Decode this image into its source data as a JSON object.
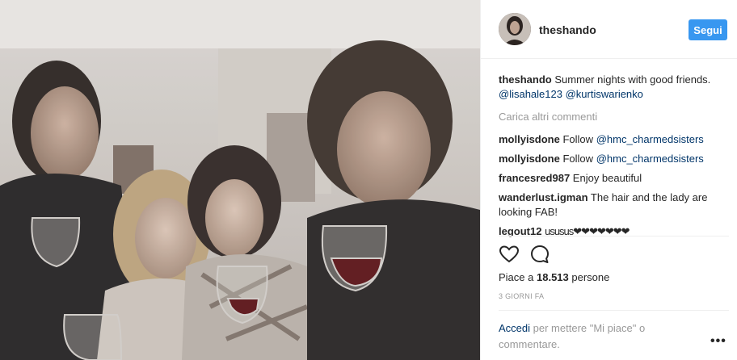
{
  "post": {
    "username": "theshando",
    "follow_label": "Segui",
    "avatar_icon": "profile-avatar",
    "photo_description_icon": "post-photo"
  },
  "caption": {
    "username": "theshando",
    "text": "Summer nights with good friends.",
    "mentions": [
      "@lisahale123",
      "@kurtiswarienko"
    ]
  },
  "load_more_label": "Carica altri commenti",
  "comments": [
    {
      "user": "mollyisdone",
      "text": "Follow",
      "mention": "@hmc_charmedsisters"
    },
    {
      "user": "mollyisdone",
      "text": "Follow",
      "mention": "@hmc_charmedsisters"
    },
    {
      "user": "francesred987",
      "text": "Enjoy beautiful",
      "mention": ""
    },
    {
      "user": "wanderlust.igman",
      "text": "The hair and the lady are looking FAB!",
      "mention": ""
    },
    {
      "user": "legout12",
      "text": "ususus❤❤❤❤❤❤❤",
      "mention": ""
    }
  ],
  "actions": {
    "like_icon": "heart-icon",
    "comment_icon": "comment-icon"
  },
  "likes": {
    "prefix": "Piace a",
    "count": "18.513",
    "suffix": "persone"
  },
  "timestamp": "3 GIORNI FA",
  "login": {
    "link_label": "Accedi",
    "rest": "per mettere \"Mi piace\" o commentare."
  },
  "more_label": "•••",
  "colors": {
    "accent": "#3897f0",
    "link": "#003569",
    "muted": "#999999",
    "text": "#262626"
  }
}
